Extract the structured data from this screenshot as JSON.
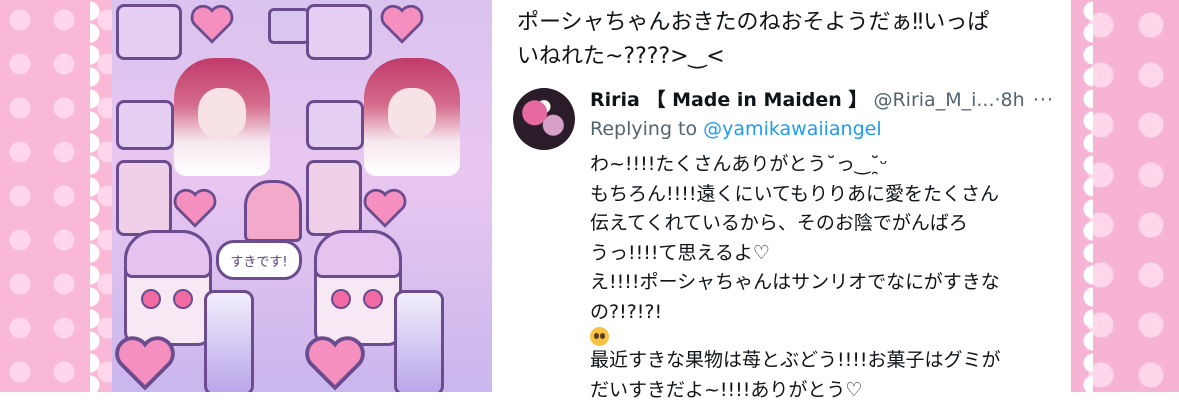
{
  "colors": {
    "frame_pink": "#f9b9d6",
    "text_primary": "#0f1419",
    "text_secondary": "#536471",
    "link_blue": "#1d9bf0",
    "art_lavender": "#d9c3ef"
  },
  "illustration": {
    "bubble_text": "すきです!"
  },
  "post": {
    "lines": [
      "ポーシャちゃんおきたのねおそようだぁ‼︎いっぱ",
      "いねれた~????>‿<"
    ]
  },
  "reply": {
    "display_name": "Riria 【 Made in Maiden 】",
    "handle": "@Riria_M_i...",
    "separator": "·",
    "time": "8h",
    "more_icon": "ellipsis-icon",
    "more_label": "···",
    "replying_prefix": "Replying to",
    "replying_mention": "@yamikawaiiangel",
    "body_lines": [
      "わ~!!!!たくさんありがとう˘っ‿˘̯ᵕ",
      "もちろん!!!!遠くにいてもりりあに愛をたくさん",
      "伝えてくれているから、そのお陰でがんばろ",
      "うっ!!!!て思えるよ♡",
      "え!!!!ポーシャちゃんはサンリオでなにがすきな",
      "の?!?!?!",
      "最近すきな果物は苺とぶどう!!!!お菓子はグミが",
      "だいすきだよ~!!!!ありがとう♡"
    ],
    "emoji_icon": "pleading-face-emoji"
  }
}
